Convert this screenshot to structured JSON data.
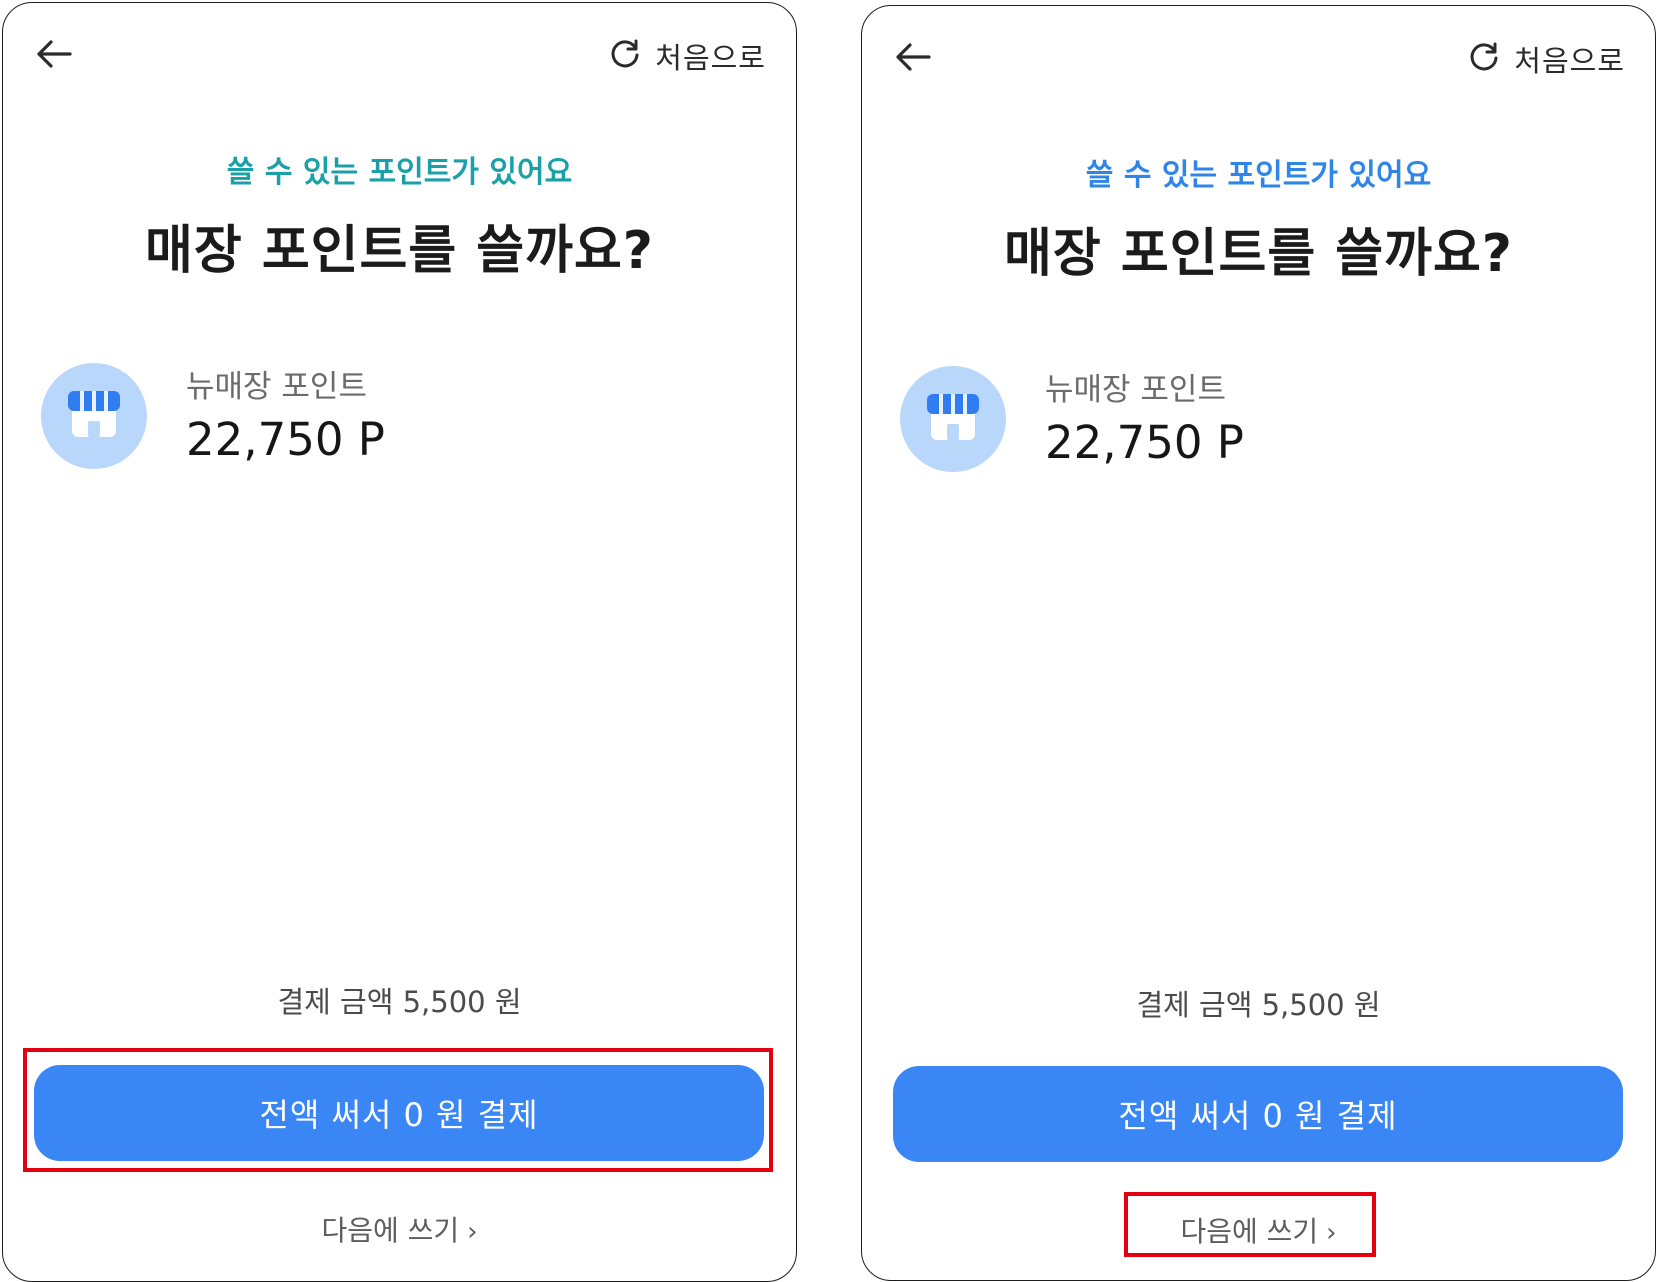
{
  "colors": {
    "accent_blue": "#3a86f5",
    "subtitle_teal": "#1aa0a8",
    "subtitle_blue": "#2f86e8",
    "icon_bg": "#b9d7fa",
    "icon_stripe": "#2f7df0",
    "highlight_red": "#e3000f"
  },
  "screens": [
    {
      "header": {
        "back_icon": "arrow-left-icon",
        "restart_icon": "refresh-icon",
        "restart_label": "처음으로"
      },
      "subtitle": "쓸 수 있는 포인트가 있어요",
      "title": "매장 포인트를 쓸까요?",
      "point": {
        "icon": "store-icon",
        "name": "뉴매장 포인트",
        "value": "22,750 P"
      },
      "payment_amount": "결제 금액 5,500 원",
      "primary_button": "전액 써서 0 원 결제",
      "secondary_link": "다음에 쓰기",
      "secondary_link_icon": "chevron-right-icon"
    },
    {
      "header": {
        "back_icon": "arrow-left-icon",
        "restart_icon": "refresh-icon",
        "restart_label": "처음으로"
      },
      "subtitle": "쓸 수 있는 포인트가 있어요",
      "title": "매장 포인트를 쓸까요?",
      "point": {
        "icon": "store-icon",
        "name": "뉴매장 포인트",
        "value": "22,750 P"
      },
      "payment_amount": "결제 금액 5,500 원",
      "primary_button": "전액 써서 0 원 결제",
      "secondary_link": "다음에 쓰기",
      "secondary_link_icon": "chevron-right-icon"
    }
  ]
}
